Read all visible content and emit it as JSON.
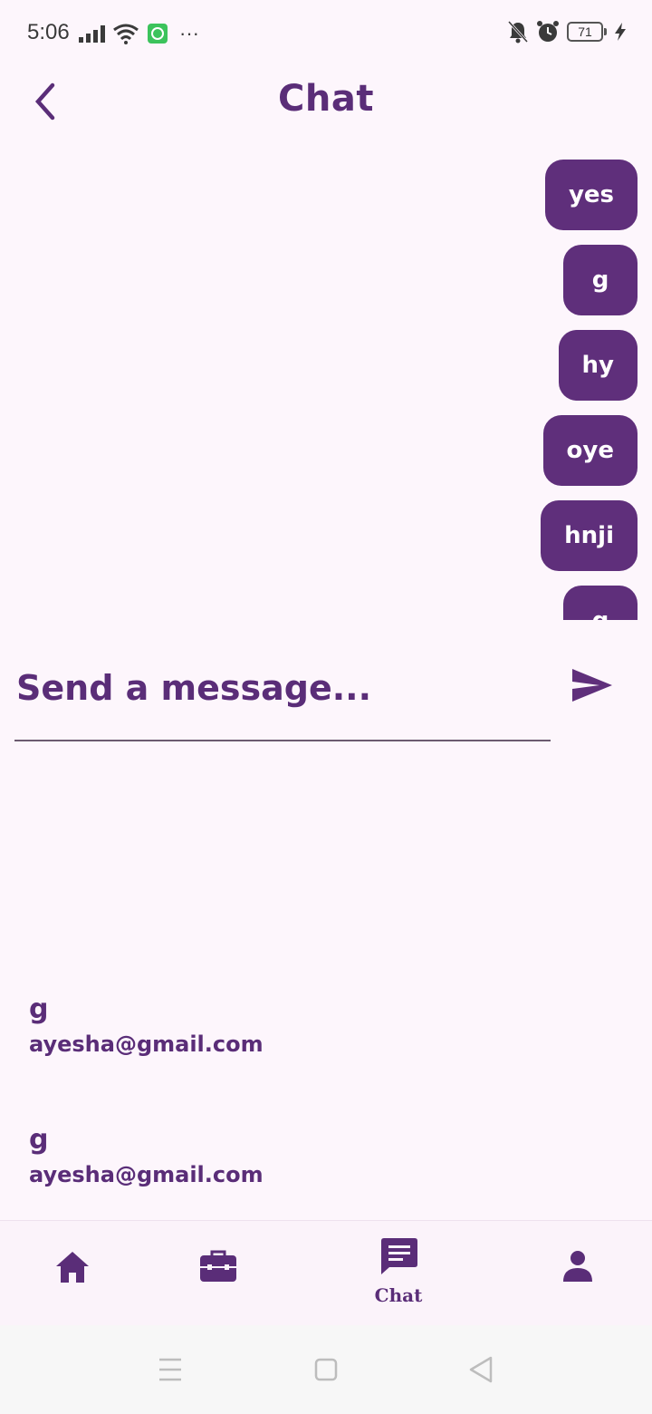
{
  "status_bar": {
    "time": "5:06",
    "more": "···",
    "battery": "71",
    "icons": [
      "signal-icon",
      "wifi-icon",
      "whatsapp-icon",
      "mute-icon",
      "alarm-icon",
      "battery-icon",
      "charging-icon"
    ]
  },
  "header": {
    "title": "Chat",
    "back_icon": "chevron-left-icon"
  },
  "messages": [
    {
      "text": "yes"
    },
    {
      "text": "g"
    },
    {
      "text": "hy"
    },
    {
      "text": "oye"
    },
    {
      "text": "hnji"
    },
    {
      "text": "g"
    }
  ],
  "composer": {
    "placeholder": "Send a message...",
    "value": "",
    "send_icon": "send-icon"
  },
  "contacts": [
    {
      "name": "g",
      "email": "ayesha@gmail.com"
    },
    {
      "name": "g",
      "email": "ayesha@gmail.com"
    }
  ],
  "bottom_nav": {
    "items": [
      {
        "icon": "home-icon",
        "label": ""
      },
      {
        "icon": "briefcase-icon",
        "label": ""
      },
      {
        "icon": "chat-icon",
        "label": "Chat"
      },
      {
        "icon": "person-icon",
        "label": ""
      }
    ],
    "active": "Chat"
  },
  "colors": {
    "primary": "#5f2f7b",
    "text": "#5a2d78",
    "background": "#fdf6fc"
  }
}
